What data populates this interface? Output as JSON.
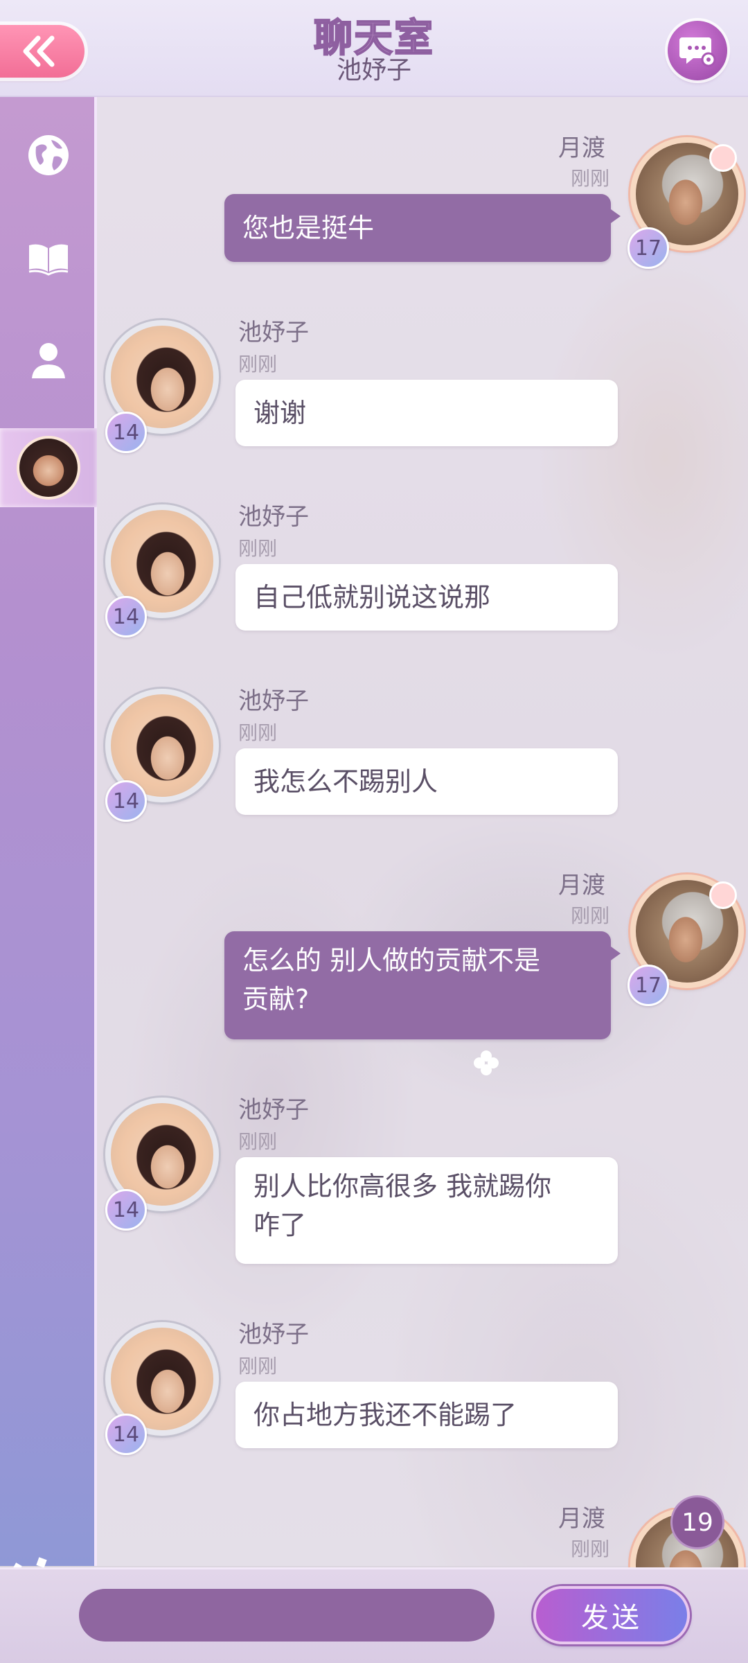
{
  "header": {
    "title": "聊天室",
    "subtitle": "池妤子",
    "back_icon": "double-chevron-left-icon",
    "settings_icon": "chat-settings-icon"
  },
  "sidebar": {
    "items": [
      {
        "icon": "globe-icon",
        "label": "world"
      },
      {
        "icon": "book-icon",
        "label": "story"
      },
      {
        "icon": "person-icon",
        "label": "friends"
      },
      {
        "icon": "avatar",
        "label": "private-chat",
        "selected": true
      }
    ]
  },
  "messages": [
    {
      "side": "right",
      "name": "月渡",
      "time": "刚刚",
      "text": "您也是挺牛",
      "level": "17"
    },
    {
      "side": "left",
      "name": "池妤子",
      "time": "刚刚",
      "text": "谢谢",
      "level": "14"
    },
    {
      "side": "left",
      "name": "池妤子",
      "time": "刚刚",
      "text": "自己低就别说这说那",
      "level": "14"
    },
    {
      "side": "left",
      "name": "池妤子",
      "time": "刚刚",
      "text": "我怎么不踢别人",
      "level": "14"
    },
    {
      "side": "right",
      "name": "月渡",
      "time": "刚刚",
      "text_line1": "怎么的 别人做的贡献不是",
      "text_line2": "贡献?",
      "level": "17"
    },
    {
      "side": "left",
      "name": "池妤子",
      "time": "刚刚",
      "text_line1": "别人比你高很多 我就踢你",
      "text_line2": "咋了",
      "level": "14"
    },
    {
      "side": "left",
      "name": "池妤子",
      "time": "刚刚",
      "text": "你占地方我还不能踢了",
      "level": "14"
    },
    {
      "side": "right",
      "name": "月渡",
      "time": "刚刚",
      "level": "19"
    }
  ],
  "input": {
    "value": "",
    "placeholder": ""
  },
  "send_button": {
    "label": "发送"
  },
  "colors": {
    "accent": "#926ca5",
    "sidebar_top": "#c49ad0",
    "sidebar_bottom": "#8f98d6",
    "back_button": "#f26e96"
  }
}
